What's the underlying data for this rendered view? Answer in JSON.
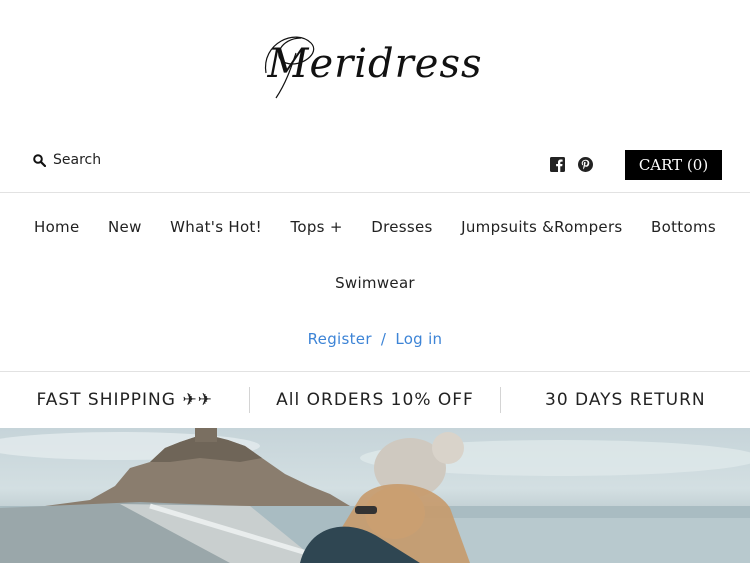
{
  "header": {
    "logo_text": "Meridress",
    "search_label": "Search",
    "cart_label": "CART (0)"
  },
  "social": {
    "facebook_icon": "facebook-icon",
    "pinterest_icon": "pinterest-icon"
  },
  "nav": {
    "items": [
      {
        "label": "Home"
      },
      {
        "label": "New"
      },
      {
        "label": "What's Hot!"
      },
      {
        "label": "Tops +"
      },
      {
        "label": "Dresses"
      },
      {
        "label": "Jumpsuits &Rompers"
      },
      {
        "label": "Bottoms"
      },
      {
        "label": "Swimwear"
      }
    ]
  },
  "account": {
    "register_label": "Register",
    "separator": "/",
    "login_label": "Log in"
  },
  "promo": {
    "shipping": "FAST SHIPPING ✈✈",
    "discount": "All ORDERS 10% OFF",
    "returns": "30 DAYS RETURN"
  },
  "colors": {
    "link": "#3d84d6",
    "cart_bg": "#000000",
    "divider": "#e2e2e2"
  }
}
